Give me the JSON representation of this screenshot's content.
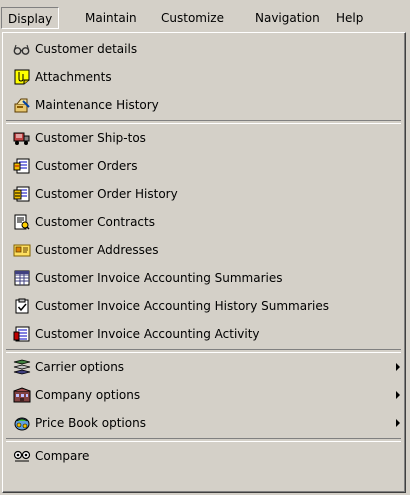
{
  "menubar": {
    "items": [
      {
        "label": "Display"
      },
      {
        "label": "Maintain"
      },
      {
        "label": "Customize"
      },
      {
        "label": "Navigation"
      },
      {
        "label": "Help"
      }
    ]
  },
  "display_menu": {
    "items": [
      {
        "label": "Customer details",
        "icon": "glasses-icon"
      },
      {
        "label": "Attachments",
        "icon": "attachment-note-icon"
      },
      {
        "label": "Maintenance History",
        "icon": "maintenance-history-icon"
      },
      {
        "label": "Customer Ship-tos",
        "icon": "ship-to-truck-icon"
      },
      {
        "label": "Customer Orders",
        "icon": "customer-orders-icon"
      },
      {
        "label": "Customer Order History",
        "icon": "order-history-icon"
      },
      {
        "label": "Customer Contracts",
        "icon": "contract-document-icon"
      },
      {
        "label": "Customer Addresses",
        "icon": "address-card-icon"
      },
      {
        "label": "Customer Invoice Accounting Summaries",
        "icon": "invoice-summary-icon"
      },
      {
        "label": "Customer Invoice Accounting History Summaries",
        "icon": "checkbox-history-icon"
      },
      {
        "label": "Customer Invoice Accounting Activity",
        "icon": "invoice-activity-icon"
      },
      {
        "label": "Carrier options",
        "icon": "carrier-icon",
        "submenu": true
      },
      {
        "label": "Company options",
        "icon": "company-icon",
        "submenu": true
      },
      {
        "label": "Price Book options",
        "icon": "price-book-icon",
        "submenu": true
      },
      {
        "label": "Compare",
        "icon": "compare-icon"
      }
    ]
  },
  "colors": {
    "face": "#d4d0c8",
    "shadow": "#808080",
    "highlight": "#ffffff"
  }
}
